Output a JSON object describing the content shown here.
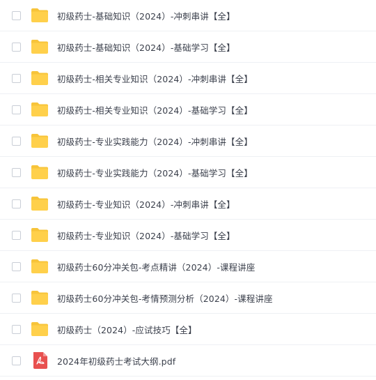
{
  "files": [
    {
      "name": "初级药士-基础知识（2024）-冲刺串讲【全】",
      "type": "folder",
      "icon": "folder-icon"
    },
    {
      "name": "初级药士-基础知识（2024）-基础学习【全】",
      "type": "folder",
      "icon": "folder-icon"
    },
    {
      "name": "初级药士-相关专业知识（2024）-冲刺串讲【全】",
      "type": "folder",
      "icon": "folder-icon"
    },
    {
      "name": "初级药士-相关专业知识（2024）-基础学习【全】",
      "type": "folder",
      "icon": "folder-icon"
    },
    {
      "name": "初级药士-专业实践能力（2024）-冲刺串讲【全】",
      "type": "folder",
      "icon": "folder-icon"
    },
    {
      "name": "初级药士-专业实践能力（2024）-基础学习【全】",
      "type": "folder",
      "icon": "folder-icon"
    },
    {
      "name": "初级药士-专业知识（2024）-冲刺串讲【全】",
      "type": "folder",
      "icon": "folder-icon"
    },
    {
      "name": "初级药士-专业知识（2024）-基础学习【全】",
      "type": "folder",
      "icon": "folder-icon"
    },
    {
      "name": "初级药士60分冲关包-考点精讲（2024）-课程讲座",
      "type": "folder",
      "icon": "folder-icon"
    },
    {
      "name": "初级药士60分冲关包-考情预测分析（2024）-课程讲座",
      "type": "folder",
      "icon": "folder-icon"
    },
    {
      "name": "初级药士（2024）-应试技巧【全】",
      "type": "folder",
      "icon": "folder-icon"
    },
    {
      "name": "2024年初级药士考试大纲.pdf",
      "type": "pdf",
      "icon": "pdf-icon"
    }
  ],
  "colors": {
    "folder": "#ffd04b",
    "folder_tab": "#f7c43a",
    "pdf": "#e8504f",
    "row_border": "#eef0f4",
    "text": "#3a3f4b"
  }
}
